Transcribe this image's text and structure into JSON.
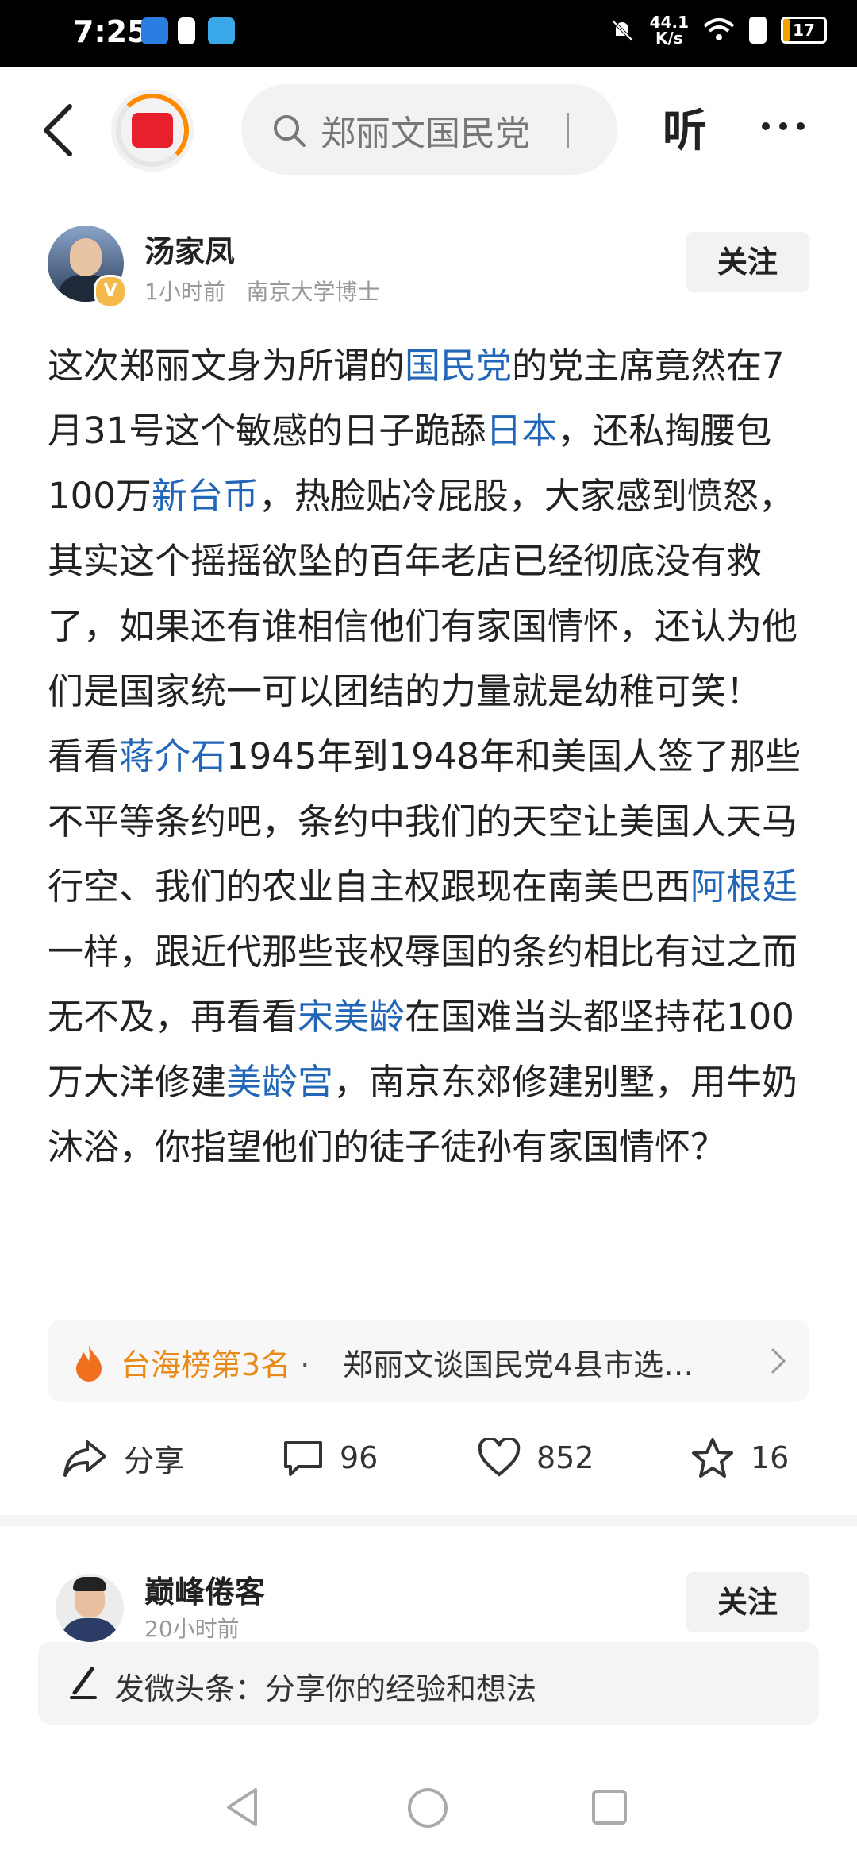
{
  "status_bar": {
    "time": "7:25",
    "net_speed_value": "44.1",
    "net_speed_unit": "K/s",
    "battery_level": "17",
    "icons": [
      "shield-icon",
      "alert-icon",
      "cloud-icon",
      "mute-bell-icon",
      "wifi-icon",
      "alert-icon",
      "battery-icon"
    ]
  },
  "header": {
    "back_icon": "chevron-left-icon",
    "search_placeholder": "郑丽文国民党",
    "listen_label": "听",
    "more_icon": "ellipsis-icon"
  },
  "post": {
    "author": {
      "name": "汤家凤",
      "time": "1小时前",
      "bio": "南京大学博士",
      "verified_badge": "V",
      "follow_label": "关注"
    },
    "paragraphs": [
      [
        {
          "text": "这次郑丽文身为所谓的",
          "link": false
        },
        {
          "text": "国民党",
          "link": true
        },
        {
          "text": "的党主席竟然在7月31号这个敏感的日子跪舔",
          "link": false
        },
        {
          "text": "日本",
          "link": true
        },
        {
          "text": "，还私掏腰包100万",
          "link": false
        },
        {
          "text": "新台币",
          "link": true
        },
        {
          "text": "，热脸贴冷屁股，大家感到愤怒，其实这个摇摇欲坠的百年老店已经彻底没有救了，如果还有谁相信他们有家国情怀，还认为他们是国家统一可以团结的力量就是幼稚可笑！",
          "link": false
        }
      ],
      [
        {
          "text": "看看",
          "link": false
        },
        {
          "text": "蒋介石",
          "link": true
        },
        {
          "text": "1945年到1948年和美国人签了那些不平等条约吧，条约中我们的天空让美国人天马行空、我们的农业自主权跟现在南美巴西",
          "link": false
        },
        {
          "text": "阿根廷",
          "link": true
        },
        {
          "text": "一样，跟近代那些丧权辱国的条约相比有过之而无不及，再看看",
          "link": false
        },
        {
          "text": "宋美龄",
          "link": true
        },
        {
          "text": "在国难当头都坚持花100万大洋修建",
          "link": false
        },
        {
          "text": "美龄宫",
          "link": true
        },
        {
          "text": "，南京东郊修建别墅，用牛奶沐浴，你指望他们的徒子徒孙有家国情怀？",
          "link": false
        }
      ]
    ],
    "hot": {
      "rank": "台海榜第3名",
      "separator": "·",
      "title": "郑丽文谈国民党4县市选…"
    },
    "actions": {
      "share_label": "分享",
      "comments": "96",
      "likes": "852",
      "favorites": "16"
    },
    "link_color": "#2266b8"
  },
  "next_post": {
    "author": {
      "name": "巅峰倦客",
      "time": "20小时前",
      "follow_label": "关注"
    }
  },
  "composer": {
    "label": "发微头条：分享你的经验和想法"
  },
  "nav_bar": {
    "icons": [
      "back-triangle-icon",
      "home-circle-icon",
      "recents-square-icon"
    ]
  }
}
